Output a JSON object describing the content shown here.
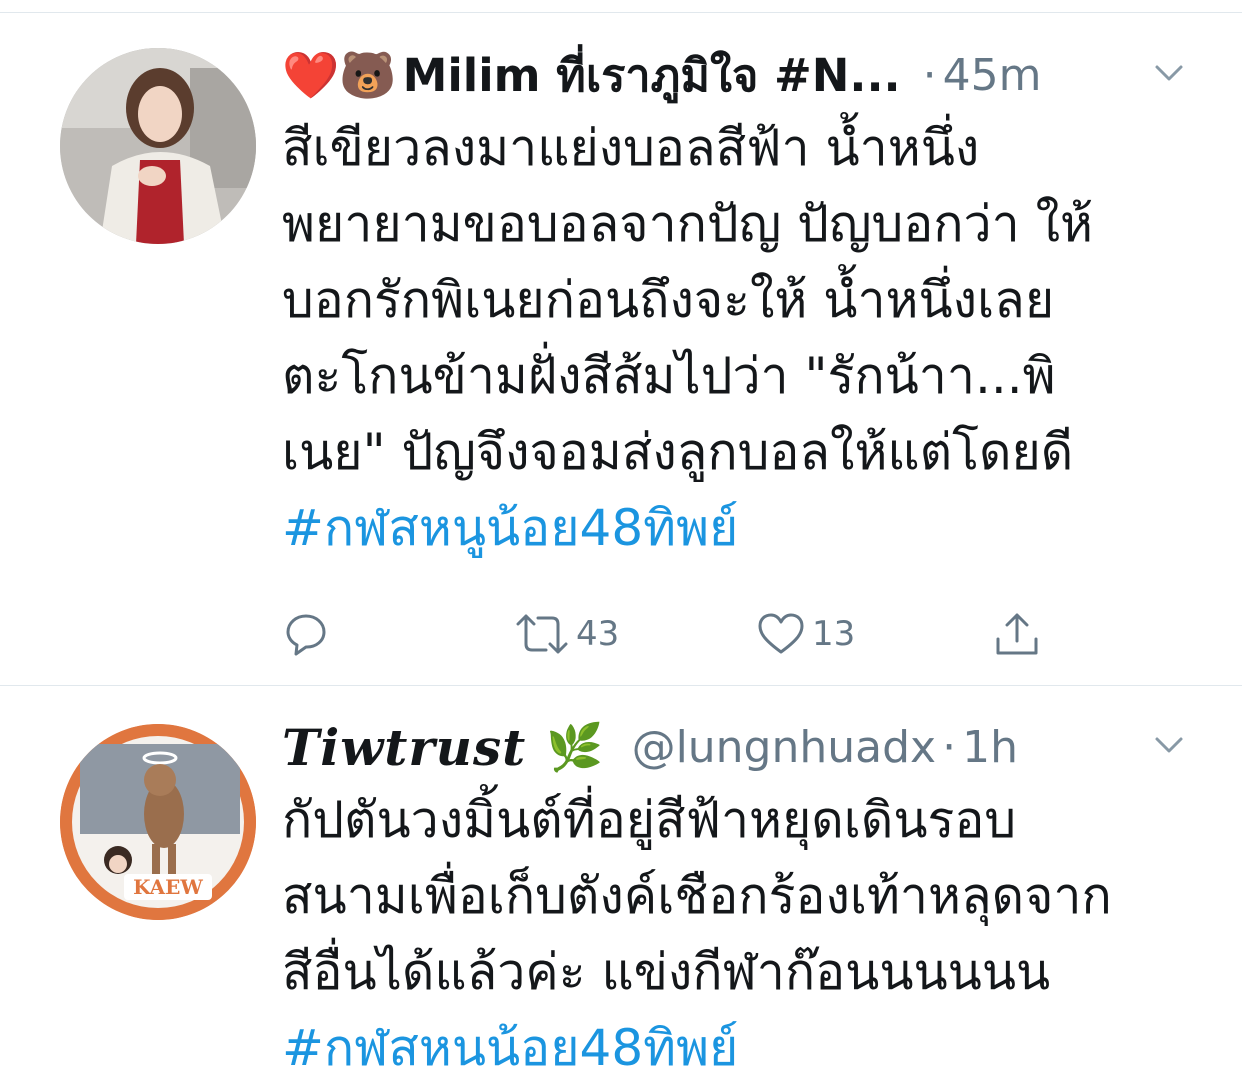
{
  "tweets": [
    {
      "display_name": "Milim ที่เราภูมิใจ #N...",
      "emoji": "❤️🐻",
      "dot": "·",
      "time": "45m",
      "body_lines": [
        "สีเขียวลงมาแย่งบอลสีฟ้า น้ำหนึ่ง",
        "พยายามขอบอลจากปัญ ปัญบอกว่า ให้",
        "บอกรักพิเนยก่อนถึงจะให้ น้ำหนึ่งเลย",
        "ตะโกนข้ามฝั่งสีส้มไปว่า \"รักน้าา...พิ",
        "เนย\" ปัญจึงจอมส่งลูกบอลให้แต่โดยดี"
      ],
      "hashtag": "#กฬสหนูน้อย48ทิพย์",
      "retweets": "43",
      "likes": "13"
    },
    {
      "display_name": "Tiwtrust",
      "emoji": "🌿",
      "handle": "@lungnhuadx",
      "dot": "·",
      "time": "1h",
      "body_lines": [
        "กัปตันวงมิ้นต์ที่อยู่สีฟ้าหยุดเดินรอบ",
        "สนามเพื่อเก็บตังค์เชือกร้องเท้าหลุดจาก",
        "สีอื่นได้แล้วค่ะ แข่งกีฬาก๊อนนนนนน"
      ],
      "hashtag": "#กฬสหนน้อย48ทิพย์"
    }
  ],
  "colors": {
    "text": "#14171a",
    "secondary": "#657786",
    "link": "#1b95e0",
    "divider": "#e1e8ed"
  },
  "icons": [
    "reply-icon",
    "retweet-icon",
    "like-icon",
    "share-icon",
    "chevron-down-icon"
  ]
}
